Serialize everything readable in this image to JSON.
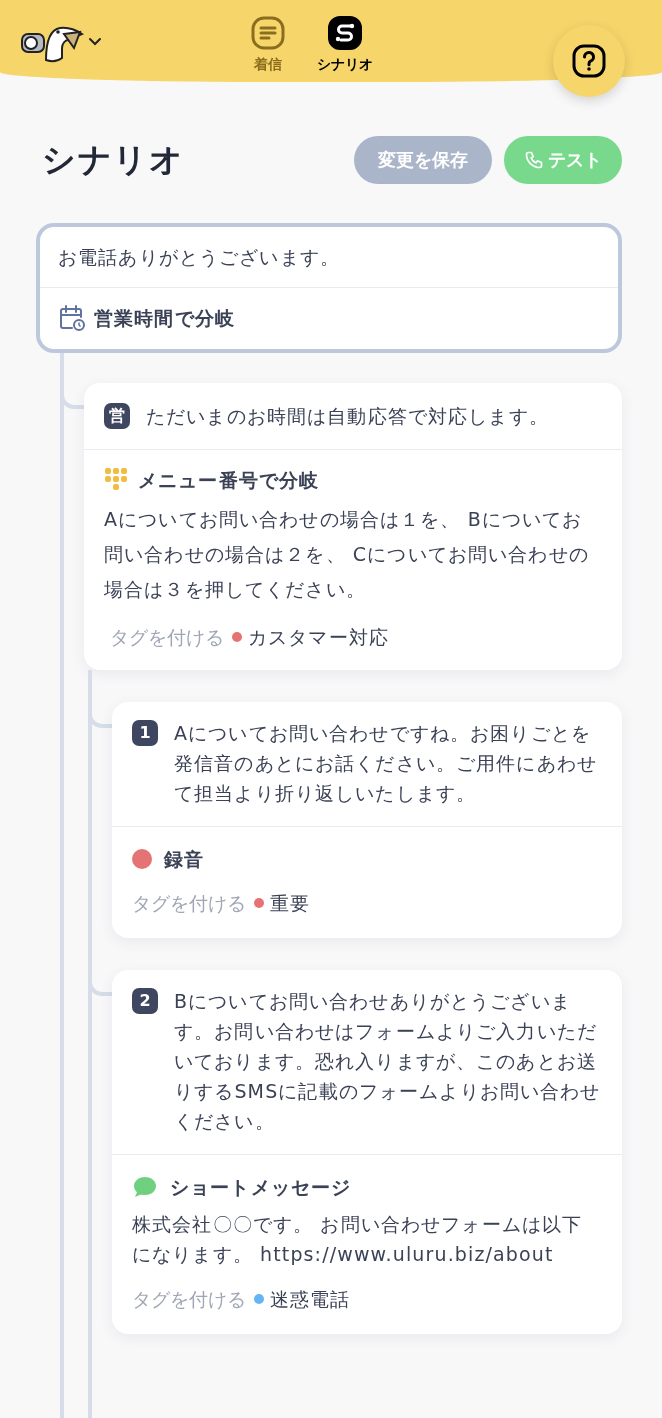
{
  "nav_tabs": [
    {
      "label": "着信",
      "kind": "inbox",
      "selected": false
    },
    {
      "label": "シナリオ",
      "kind": "scenario",
      "selected": true
    }
  ],
  "title": "シナリオ",
  "buttons": {
    "save": {
      "label": "変更を保存",
      "disabled": true
    },
    "test": {
      "label": "テスト"
    }
  },
  "root": {
    "greeting": "お電話ありがとうございます。",
    "branch_label": "営業時間で分岐"
  },
  "node": {
    "badge": "営",
    "message": "ただいまのお時間は自動応答で対応します。",
    "branch_label": "メニュー番号で分岐",
    "branch_text": "Aについてお問い合わせの場合は１を、 Bについてお問い合わせの場合は２を、 Cについてお問い合わせの場合は３を押してください。",
    "tag_prompt": "タグを付ける",
    "tag": {
      "label": "カスタマー対応",
      "color": "#e57373"
    }
  },
  "options": [
    {
      "number": "1",
      "message": "Aについてお問い合わせですね。お困りごとを発信音のあとにお話ください。ご用件にあわせて担当より折り返しいたします。",
      "action": {
        "kind": "recording",
        "label": "録音"
      },
      "tag_prompt": "タグを付ける",
      "tag": {
        "label": "重要",
        "color": "#e57373"
      }
    },
    {
      "number": "2",
      "message": "Bについてお問い合わせありがとうございます。お問い合わせはフォームよりご入力いただいております。恐れ入りますが、このあとお送りするSMSに記載のフォームよりお問い合わせください。",
      "action": {
        "kind": "sms",
        "label": "ショートメッセージ",
        "text": "株式会社〇〇です。 お問い合わせフォームは以下になります。 https://www.uluru.biz/about"
      },
      "tag_prompt": "タグを付ける",
      "tag": {
        "label": "迷惑電話",
        "color": "#64b5f6"
      }
    }
  ]
}
